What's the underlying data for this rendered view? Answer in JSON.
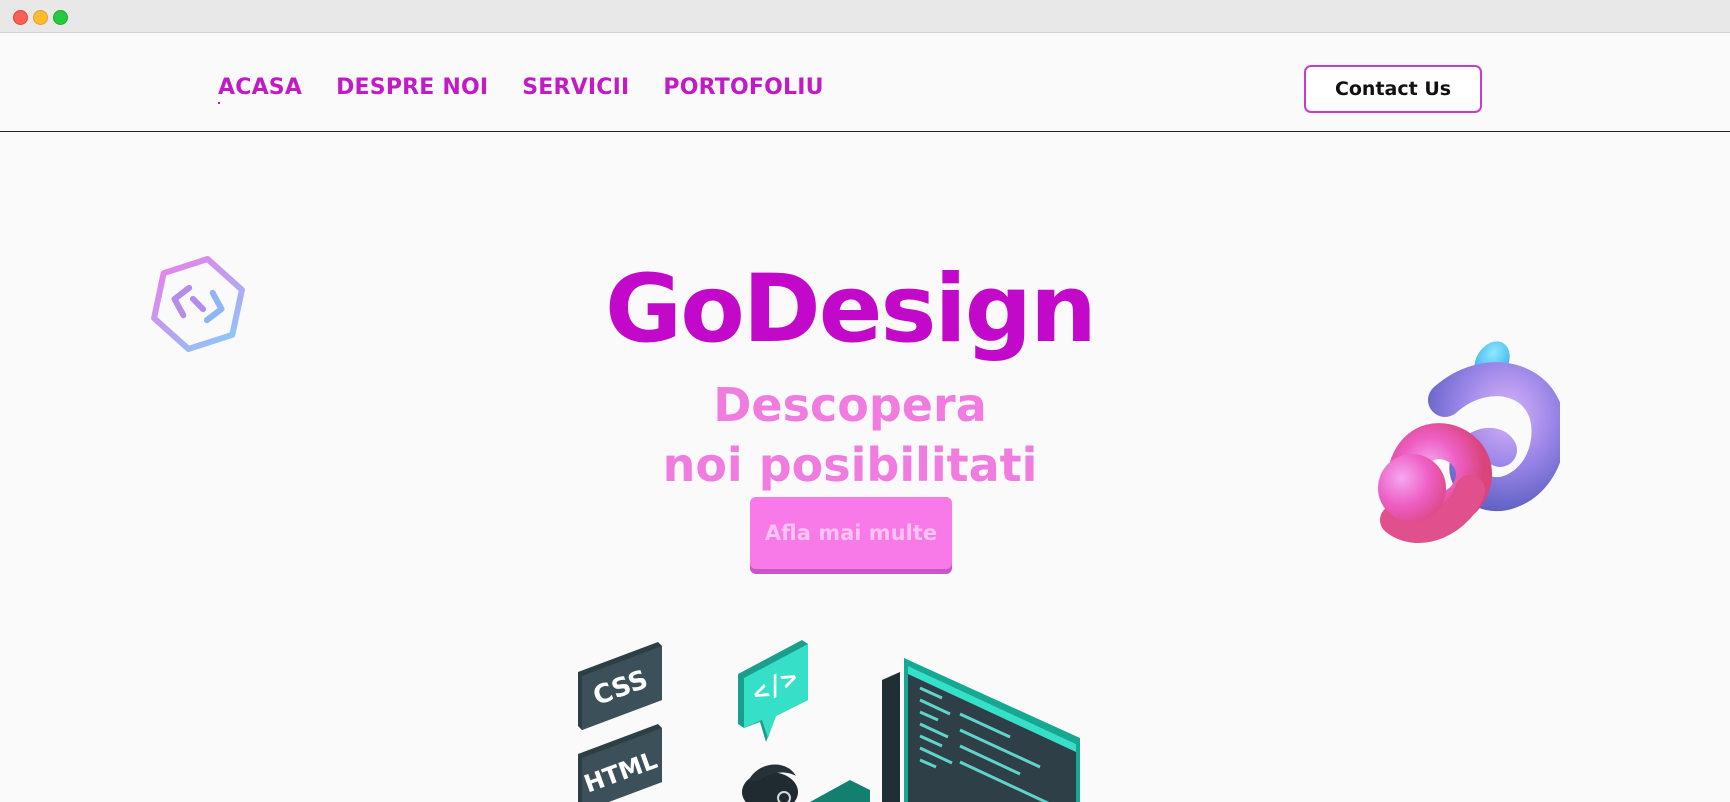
{
  "window": {
    "controls": [
      "close",
      "minimize",
      "maximize"
    ]
  },
  "nav": {
    "links": [
      {
        "label": "ACASA",
        "active": true
      },
      {
        "label": "DESPRE NOI"
      },
      {
        "label": "SERVICII"
      },
      {
        "label": "PORTOFOLIU"
      }
    ],
    "contact_label": "Contact Us"
  },
  "hero": {
    "title": "GoDesign",
    "subtitle_line1": "Descopera",
    "subtitle_line2": "noi posibilitati",
    "cta_label": "Afla mai multe"
  },
  "illustration": {
    "tags": [
      "CSS",
      "HTML"
    ],
    "code_bubble": "</>"
  },
  "colors": {
    "brand": "#c208c9",
    "subtitle": "#f07ce0",
    "cta": "#f77ae8"
  }
}
